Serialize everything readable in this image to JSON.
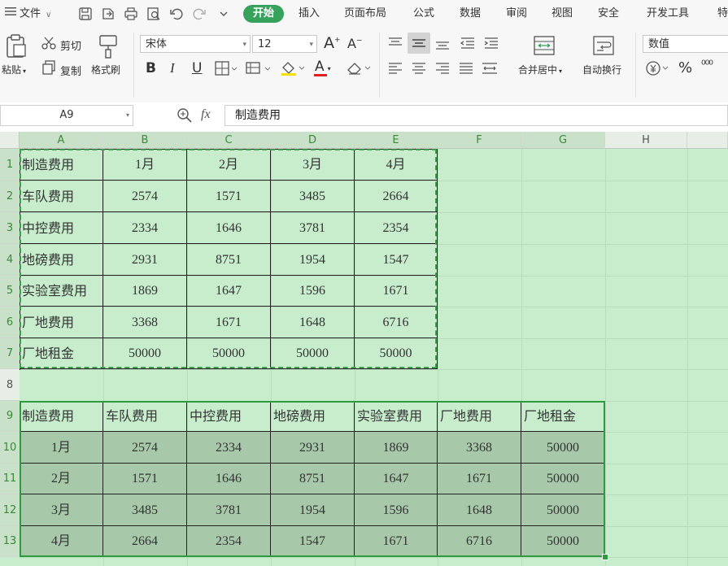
{
  "menu": {
    "file": "文件",
    "tabs": [
      "开始",
      "插入",
      "页面布局",
      "公式",
      "数据",
      "审阅",
      "视图",
      "安全",
      "开发工具",
      "特"
    ],
    "active_tab": "开始"
  },
  "ribbon": {
    "paste": "粘贴",
    "cut": "剪切",
    "copy": "复制",
    "format_painter": "格式刷",
    "font_name": "宋体",
    "font_size": "12",
    "merge_center": "合并居中",
    "wrap_text": "自动换行",
    "number_format": "数值",
    "percent": "%",
    "bold": "B",
    "italic": "I",
    "underline": "U",
    "grow_font": "A",
    "shrink_font": "A",
    "font_color": "A",
    "accent_color": "#36a25c",
    "font_color_bar": "#e02020",
    "fill_color_bar": "#f5e100"
  },
  "formula_bar": {
    "name_box": "A9",
    "fx": "fx",
    "content": "制造费用"
  },
  "columns": [
    "A",
    "B",
    "C",
    "D",
    "E",
    "F",
    "G",
    "H"
  ],
  "rows": [
    "1",
    "2",
    "3",
    "4",
    "5",
    "6",
    "7",
    "8",
    "9",
    "10",
    "11",
    "12",
    "13"
  ],
  "table1": {
    "header": [
      "制造费用",
      "1月",
      "2月",
      "3月",
      "4月"
    ],
    "rows": [
      [
        "车队费用",
        "2574",
        "1571",
        "3485",
        "2664"
      ],
      [
        "中控费用",
        "2334",
        "1646",
        "3781",
        "2354"
      ],
      [
        "地磅费用",
        "2931",
        "8751",
        "1954",
        "1547"
      ],
      [
        "实验室费用",
        "1869",
        "1647",
        "1596",
        "1671"
      ],
      [
        "厂地费用",
        "3368",
        "1671",
        "1648",
        "6716"
      ],
      [
        "厂地租金",
        "50000",
        "50000",
        "50000",
        "50000"
      ]
    ]
  },
  "table2": {
    "header": [
      "制造费用",
      "车队费用",
      "中控费用",
      "地磅费用",
      "实验室费用",
      "厂地费用",
      "厂地租金"
    ],
    "rows": [
      [
        "1月",
        "2574",
        "2334",
        "2931",
        "1869",
        "3368",
        "50000"
      ],
      [
        "2月",
        "1571",
        "1646",
        "8751",
        "1647",
        "1671",
        "50000"
      ],
      [
        "3月",
        "3485",
        "3781",
        "1954",
        "1596",
        "1648",
        "50000"
      ],
      [
        "4月",
        "2664",
        "2354",
        "1547",
        "1671",
        "6716",
        "50000"
      ]
    ]
  }
}
